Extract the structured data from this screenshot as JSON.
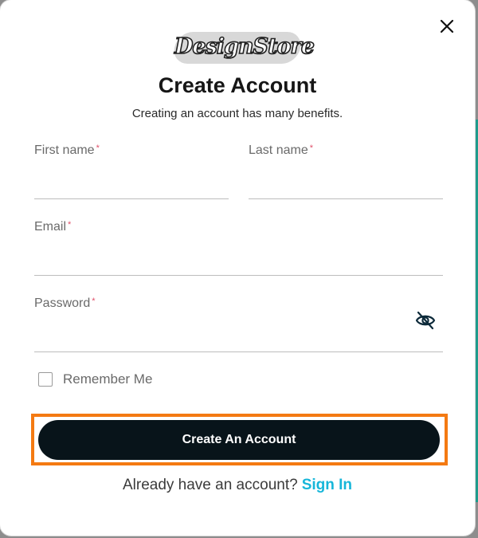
{
  "modal": {
    "logo_text": "DesignStore",
    "title": "Create Account",
    "subtitle": "Creating an account has many benefits.",
    "required_marker": "*"
  },
  "form": {
    "first_name": {
      "label": "First name",
      "value": "",
      "placeholder": ""
    },
    "last_name": {
      "label": "Last name",
      "value": "",
      "placeholder": ""
    },
    "email": {
      "label": "Email",
      "value": "",
      "placeholder": ""
    },
    "password": {
      "label": "Password",
      "value": "",
      "placeholder": "",
      "visibility_icon": "eye-off-icon"
    },
    "remember_me": {
      "label": "Remember Me",
      "checked": false
    },
    "submit_label": "Create An Account"
  },
  "footer": {
    "prompt": "Already have an account?",
    "signin_label": "Sign In"
  },
  "colors": {
    "accent": "#16b6d9",
    "button_bg": "#08141a",
    "required": "#e0506a",
    "highlight_frame": "#f47a12"
  },
  "icons": {
    "close": "close-icon",
    "password_toggle": "eye-off-icon"
  }
}
